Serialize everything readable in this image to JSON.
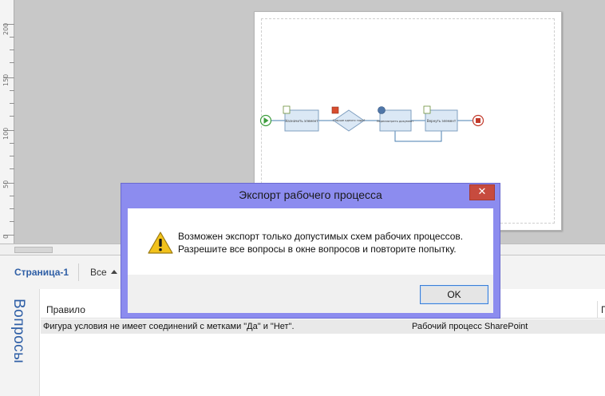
{
  "ruler": {
    "labels": [
      "200",
      "150",
      "100",
      "50",
      "0"
    ]
  },
  "diagram": {
    "node1": "Назначить элемент",
    "node2": "Старше одного года?",
    "node3": "Пересмотреть документ",
    "node4": "Вернуть элемент"
  },
  "tabbar": {
    "page_tab": "Страница-1",
    "all_label": "Все"
  },
  "issues": {
    "panel_title": "Вопросы",
    "columns": {
      "rule": "Правило",
      "extra": "П"
    },
    "rows": [
      {
        "rule": "Фигура условия не имеет соединений с метками \"Да\" и \"Нет\".",
        "category": "Рабочий процесс SharePoint"
      }
    ]
  },
  "dialog": {
    "title": "Экспорт рабочего процесса",
    "close_glyph": "✕",
    "message_line1": "Возможен экспорт только допустимых схем рабочих процессов.",
    "message_line2": "Разрешите все вопросы в окне вопросов и повторите попытку.",
    "ok_label": "OK"
  },
  "colors": {
    "dialog_frame": "#8c8cef",
    "close_button": "#c74b3e",
    "accent_blue": "#2f5fa6",
    "warning_yellow": "#f2c21b"
  }
}
